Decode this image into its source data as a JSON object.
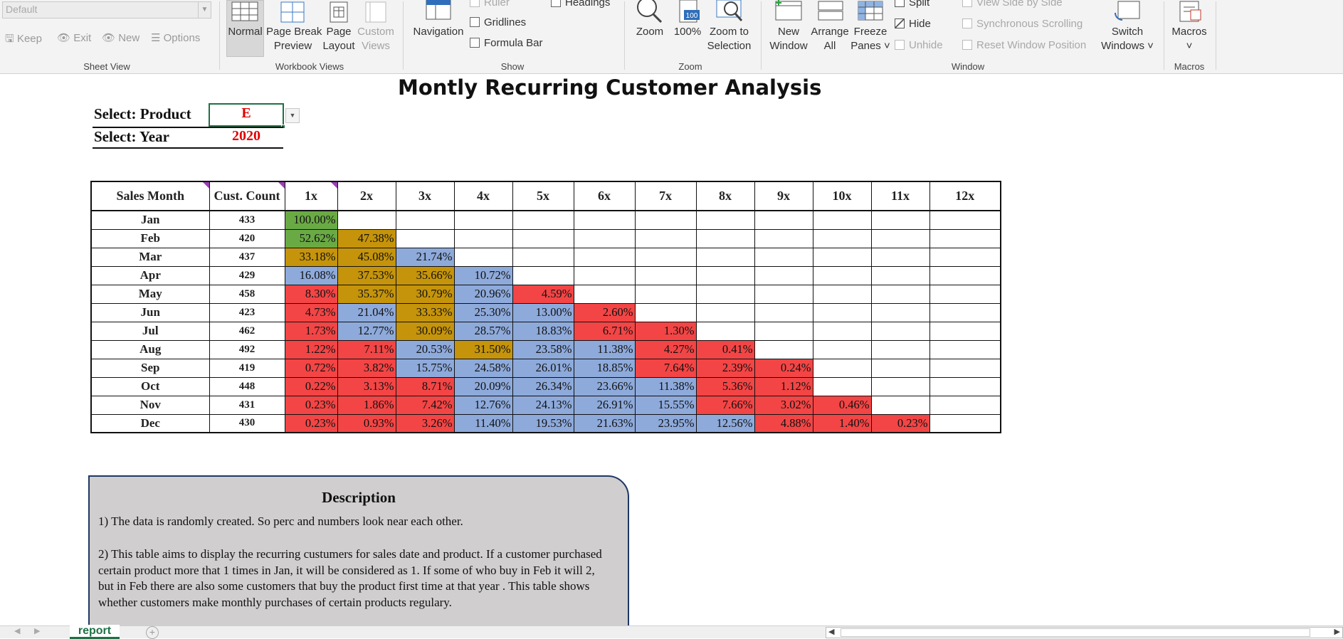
{
  "ribbon": {
    "sheet_view": {
      "dropdown_value": "Default",
      "keep": "Keep",
      "exit": "Exit",
      "new": "New",
      "options": "Options",
      "label": "Sheet View"
    },
    "workbook_views": {
      "normal": "Normal",
      "page_break_1": "Page Break",
      "page_break_2": "Preview",
      "page_layout_1": "Page",
      "page_layout_2": "Layout",
      "custom_views_1": "Custom",
      "custom_views_2": "Views",
      "label": "Workbook Views"
    },
    "show": {
      "navigation": "Navigation",
      "ruler": "Ruler",
      "gridlines": "Gridlines",
      "formula_bar": "Formula Bar",
      "headings": "Headings",
      "label": "Show"
    },
    "zoom": {
      "zoom": "Zoom",
      "hundred": "100%",
      "zoom_sel_1": "Zoom to",
      "zoom_sel_2": "Selection",
      "label": "Zoom"
    },
    "window": {
      "new_window_1": "New",
      "new_window_2": "Window",
      "arrange_1": "Arrange",
      "arrange_2": "All",
      "freeze_1": "Freeze",
      "freeze_2": "Panes ˅",
      "split": "Split",
      "hide": "Hide",
      "unhide": "Unhide",
      "side_by_side": "View Side by Side",
      "sync_scroll": "Synchronous Scrolling",
      "reset_pos": "Reset Window Position",
      "switch_1": "Switch",
      "switch_2": "Windows ˅",
      "label": "Window"
    },
    "macros": {
      "macros": "Macros",
      "chev": "˅",
      "label": "Macros"
    }
  },
  "sheet": {
    "title": "Montly Recurring Customer Analysis",
    "select_product_label": "Select: Product",
    "select_product_value": "E",
    "select_year_label": "Select: Year",
    "select_year_value": "2020",
    "table": {
      "headers": [
        "Sales Month",
        "Cust. Count",
        "1x",
        "2x",
        "3x",
        "4x",
        "5x",
        "6x",
        "7x",
        "8x",
        "9x",
        "10x",
        "11x",
        "12x"
      ],
      "rows": [
        {
          "month": "Jan",
          "count": "433",
          "cells": [
            "100.00%"
          ]
        },
        {
          "month": "Feb",
          "count": "420",
          "cells": [
            "52.62%",
            "47.38%"
          ]
        },
        {
          "month": "Mar",
          "count": "437",
          "cells": [
            "33.18%",
            "45.08%",
            "21.74%"
          ]
        },
        {
          "month": "Apr",
          "count": "429",
          "cells": [
            "16.08%",
            "37.53%",
            "35.66%",
            "10.72%"
          ]
        },
        {
          "month": "May",
          "count": "458",
          "cells": [
            "8.30%",
            "35.37%",
            "30.79%",
            "20.96%",
            "4.59%"
          ]
        },
        {
          "month": "Jun",
          "count": "423",
          "cells": [
            "4.73%",
            "21.04%",
            "33.33%",
            "25.30%",
            "13.00%",
            "2.60%"
          ]
        },
        {
          "month": "Jul",
          "count": "462",
          "cells": [
            "1.73%",
            "12.77%",
            "30.09%",
            "28.57%",
            "18.83%",
            "6.71%",
            "1.30%"
          ]
        },
        {
          "month": "Aug",
          "count": "492",
          "cells": [
            "1.22%",
            "7.11%",
            "20.53%",
            "31.50%",
            "23.58%",
            "11.38%",
            "4.27%",
            "0.41%"
          ]
        },
        {
          "month": "Sep",
          "count": "419",
          "cells": [
            "0.72%",
            "3.82%",
            "15.75%",
            "24.58%",
            "26.01%",
            "18.85%",
            "7.64%",
            "2.39%",
            "0.24%"
          ]
        },
        {
          "month": "Oct",
          "count": "448",
          "cells": [
            "0.22%",
            "3.13%",
            "8.71%",
            "20.09%",
            "26.34%",
            "23.66%",
            "11.38%",
            "5.36%",
            "1.12%"
          ]
        },
        {
          "month": "Nov",
          "count": "431",
          "cells": [
            "0.23%",
            "1.86%",
            "7.42%",
            "12.76%",
            "24.13%",
            "26.91%",
            "15.55%",
            "7.66%",
            "3.02%",
            "0.46%"
          ]
        },
        {
          "month": "Dec",
          "count": "430",
          "cells": [
            "0.23%",
            "0.93%",
            "3.26%",
            "11.40%",
            "19.53%",
            "21.63%",
            "23.95%",
            "12.56%",
            "4.88%",
            "1.40%",
            "0.23%"
          ]
        }
      ],
      "colors": {
        "green": "#6aaa45",
        "gold": "#c5940b",
        "blue": "#8eaadb",
        "red": "#f34545"
      }
    },
    "description": {
      "heading": "Description",
      "p1": "1) The data is randomly created. So perc and numbers look near each other.",
      "p2": "2) This table aims to display the recurring custumers for sales date and product. If a customer purchased certain product more that 1 times in Jan, it will be considered as 1.  If some of who buy in Feb it will 2, but in Feb there are also some customers that buy the product first  time at that year . This table shows whether customers make monthly purchases of certain products regulary."
    }
  },
  "bottom": {
    "tab_name": "report",
    "add_sheet": "+"
  }
}
